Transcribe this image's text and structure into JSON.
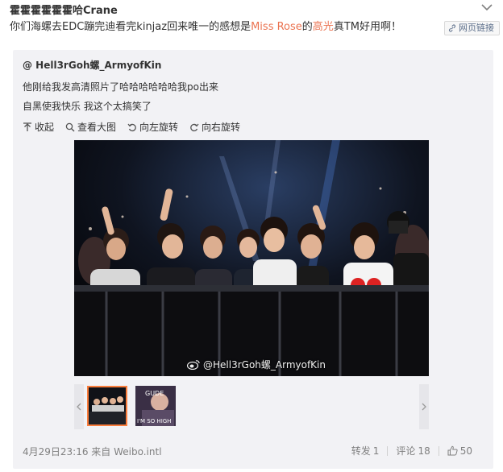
{
  "post": {
    "author": "霍霍霍霍霍霍哈Crane",
    "text_parts": [
      "你们海螺去EDC蹦完迪看完kinjaz回来唯一的感想是",
      "Miss Rose",
      "的",
      "高光",
      "真TM好用啊！"
    ],
    "link_button": "网页链接"
  },
  "repost": {
    "author": "@ Hell3rGoh螺_ArmyofKin",
    "line1": "他刚给我发高清照片了哈哈哈哈哈哈我po出来",
    "line2": "自黑使我快乐 我这个太搞笑了",
    "actions": {
      "collapse": "收起",
      "view_large": "查看大图",
      "rotate_left": "向左旋转",
      "rotate_right": "向右旋转"
    },
    "watermark": "@Hell3rGoh螺_ArmyofKin",
    "thumb2_text": "GUDE\nI'M SO HIGH",
    "timestamp": "4月29日23:16 来自 Weibo.intl",
    "repost_label": "转发",
    "repost_count": "1",
    "comment_label": "评论",
    "comment_count": "18",
    "like_count": "50"
  },
  "colors": {
    "highlight": "#eb7350",
    "link": "#5b6e8a",
    "accent": "#fa7d3c"
  },
  "icons": [
    "chevron-down-icon",
    "link-icon",
    "collapse-icon",
    "zoom-icon",
    "rotate-left-icon",
    "rotate-right-icon",
    "weibo-icon",
    "like-icon"
  ]
}
